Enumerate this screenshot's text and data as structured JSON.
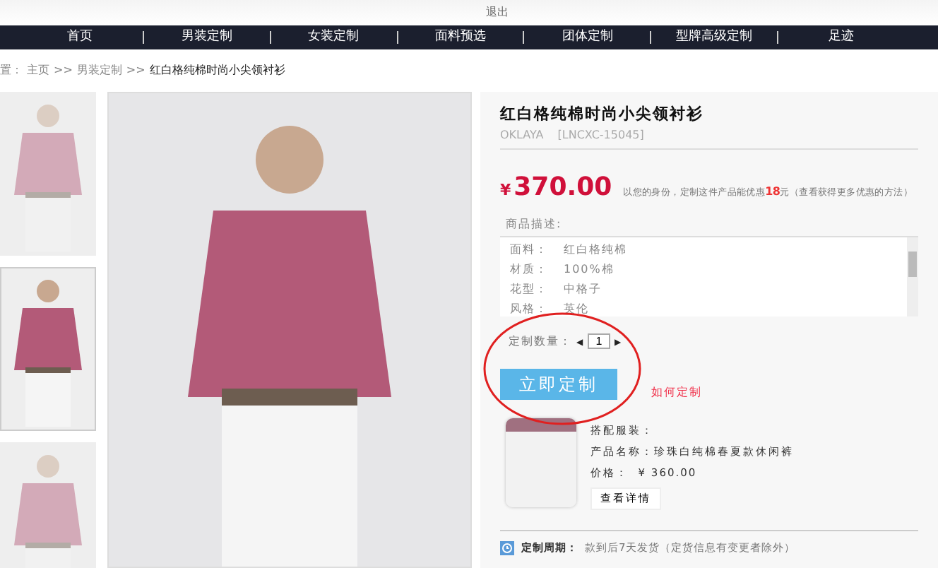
{
  "top_bar": {
    "links": [
      "退出"
    ]
  },
  "nav": [
    {
      "label": "首页"
    },
    {
      "label": "男装定制"
    },
    {
      "label": "女装定制"
    },
    {
      "label": "面料预选"
    },
    {
      "label": "团体定制"
    },
    {
      "label": "型牌高级定制"
    },
    {
      "label": "足迹"
    }
  ],
  "breadcrumb": {
    "prefix": "置：",
    "links": [
      "主页",
      "男装定制"
    ],
    "separator": ">>",
    "current": "红白格纯棉时尚小尖领衬衫"
  },
  "thumbnails": [
    {
      "selected": false,
      "faded": true
    },
    {
      "selected": true,
      "faded": false
    },
    {
      "selected": false,
      "faded": true
    }
  ],
  "product": {
    "title": "红白格纯棉时尚小尖领衬衫",
    "brand": "OKLAYA",
    "code": "[LNCXC-15045]",
    "currency": "¥",
    "price": "370.00",
    "discount_note": "以您的身份，定制这件产品能优惠**18**元（查看获得更多优惠的方法）",
    "description_label": "商品描述:",
    "specs": [
      {
        "label": "面料：",
        "value": "红白格纯棉"
      },
      {
        "label": "材质：",
        "value": "100%棉"
      },
      {
        "label": "花型：",
        "value": "中格子"
      },
      {
        "label": "风格：",
        "value": "英伦"
      }
    ],
    "quantity_label": "定制数量：",
    "quantity": "1",
    "prev": "◀",
    "next": "▶",
    "order_button": "立即定制",
    "how_link": "如何定制",
    "match": {
      "heading": "搭配服装：",
      "name": "产品名称：珍珠白纯棉春夏款休闲裤",
      "price": "价格：  ¥ 360.00",
      "button": "查看详情"
    },
    "cycle": {
      "label": "定制周期：",
      "text": "款到后7天发货（定货信息有变更者除外）"
    }
  }
}
